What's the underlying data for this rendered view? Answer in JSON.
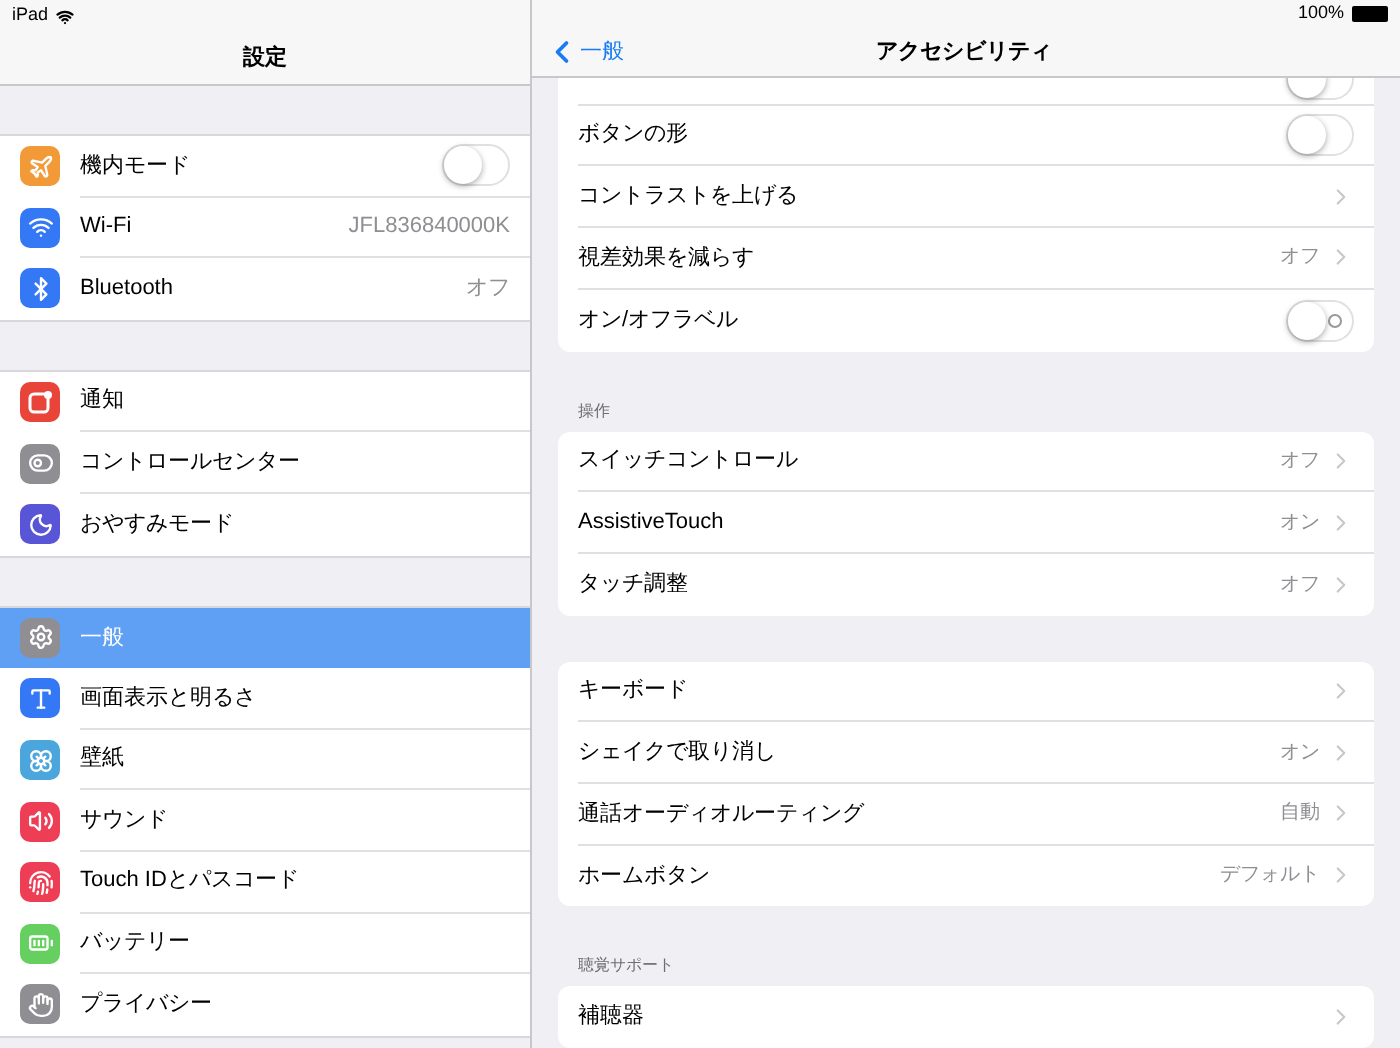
{
  "status_bar": {
    "device": "iPad",
    "battery": "100%"
  },
  "sidebar": {
    "title": "設定",
    "groups": [
      [
        {
          "label": "機内モード",
          "kind": "toggle",
          "on": false,
          "selected": false,
          "color": "#f19a37"
        },
        {
          "label": "Wi-Fi",
          "kind": "value",
          "value": "JFL836840000K",
          "selected": false,
          "color": "#3478f6"
        },
        {
          "label": "Bluetooth",
          "kind": "value",
          "value": "オフ",
          "selected": false,
          "color": "#3478f6"
        }
      ],
      [
        {
          "label": "通知",
          "kind": "link",
          "selected": false,
          "color": "#e8443a"
        },
        {
          "label": "コントロールセンター",
          "kind": "link",
          "selected": false,
          "color": "#8e8e93"
        },
        {
          "label": "おやすみモード",
          "kind": "link",
          "selected": false,
          "color": "#5856d6"
        }
      ],
      [
        {
          "label": "一般",
          "kind": "link",
          "selected": true,
          "color": "#8e8e93"
        },
        {
          "label": "画面表示と明るさ",
          "kind": "link",
          "selected": false,
          "color": "#3478f6"
        },
        {
          "label": "壁紙",
          "kind": "link",
          "selected": false,
          "color": "#4aa6dc"
        },
        {
          "label": "サウンド",
          "kind": "link",
          "selected": false,
          "color": "#ee3e55"
        },
        {
          "label": "Touch IDとパスコード",
          "kind": "link",
          "selected": false,
          "color": "#ee3e55"
        },
        {
          "label": "バッテリー",
          "kind": "link",
          "selected": false,
          "color": "#65cf5f"
        },
        {
          "label": "プライバシー",
          "kind": "link",
          "selected": false,
          "color": "#8e8e93"
        }
      ]
    ]
  },
  "detail": {
    "back": "一般",
    "title": "アクセシビリティ",
    "sections": [
      {
        "rows": [
          {
            "kind": "toggle",
            "on": false,
            "off_label": false,
            "partial": true
          },
          {
            "label": "ボタンの形",
            "kind": "toggle",
            "on": false,
            "off_label": false
          },
          {
            "label": "コントラストを上げる",
            "kind": "link"
          },
          {
            "label": "視差効果を減らす",
            "kind": "link",
            "value": "オフ"
          },
          {
            "label": "オン/オフラベル",
            "kind": "toggle",
            "on": false,
            "off_label": true
          }
        ]
      },
      {
        "header": "操作",
        "rows": [
          {
            "label": "スイッチコントロール",
            "kind": "link",
            "value": "オフ"
          },
          {
            "label": "AssistiveTouch",
            "kind": "link",
            "value": "オン"
          },
          {
            "label": "タッチ調整",
            "kind": "link",
            "value": "オフ"
          }
        ]
      },
      {
        "rows": [
          {
            "label": "キーボード",
            "kind": "link"
          },
          {
            "label": "シェイクで取り消し",
            "kind": "link",
            "value": "オン"
          },
          {
            "label": "通話オーディオルーティング",
            "kind": "link",
            "value": "自動"
          },
          {
            "label": "ホームボタン",
            "kind": "link",
            "value": "デフォルト"
          }
        ]
      },
      {
        "header": "聴覚サポート",
        "rows": [
          {
            "label": "補聴器",
            "kind": "link"
          }
        ]
      }
    ]
  }
}
